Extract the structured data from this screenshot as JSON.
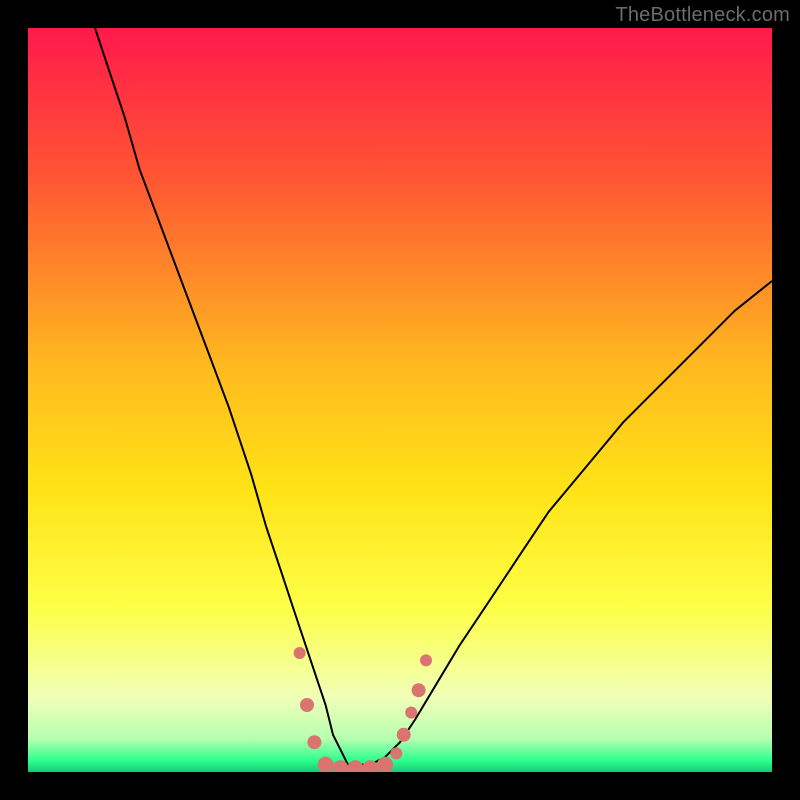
{
  "watermark": {
    "text": "TheBottleneck.com"
  },
  "chart_data": {
    "type": "line",
    "title": "",
    "xlabel": "",
    "ylabel": "",
    "xlim": [
      0,
      100
    ],
    "ylim": [
      0,
      100
    ],
    "grid": false,
    "background_gradient_stops": [
      {
        "offset": 0.0,
        "color": "#ff1a4b"
      },
      {
        "offset": 0.2,
        "color": "#ff5533"
      },
      {
        "offset": 0.45,
        "color": "#ffb81f"
      },
      {
        "offset": 0.62,
        "color": "#ffe316"
      },
      {
        "offset": 0.78,
        "color": "#fdff47"
      },
      {
        "offset": 0.9,
        "color": "#f0ffb7"
      },
      {
        "offset": 0.955,
        "color": "#b7ffb0"
      },
      {
        "offset": 0.985,
        "color": "#2bff8d"
      },
      {
        "offset": 1.0,
        "color": "#18c878"
      }
    ],
    "series": [
      {
        "name": "bottleneck-curve",
        "color": "#000000",
        "x": [
          9,
          11,
          13,
          15,
          18,
          21,
          24,
          27,
          30,
          32,
          34,
          36,
          38,
          40,
          41,
          42,
          43,
          44,
          46,
          48,
          50,
          52,
          55,
          58,
          62,
          66,
          70,
          75,
          80,
          85,
          90,
          95,
          100
        ],
        "y": [
          100,
          94,
          88,
          81,
          73,
          65,
          57,
          49,
          40,
          33,
          27,
          21,
          15,
          9,
          5,
          3,
          1,
          1,
          1,
          2,
          4,
          7,
          12,
          17,
          23,
          29,
          35,
          41,
          47,
          52,
          57,
          62,
          66
        ]
      }
    ],
    "markers": {
      "name": "bottleneck-sweet-spot",
      "color": "#d9746e",
      "points": [
        {
          "x": 36.5,
          "y": 16,
          "r": 6
        },
        {
          "x": 37.5,
          "y": 9,
          "r": 7
        },
        {
          "x": 38.5,
          "y": 4,
          "r": 7
        },
        {
          "x": 40.0,
          "y": 1,
          "r": 8
        },
        {
          "x": 42.0,
          "y": 0.5,
          "r": 8
        },
        {
          "x": 44.0,
          "y": 0.5,
          "r": 8
        },
        {
          "x": 46.0,
          "y": 0.5,
          "r": 8
        },
        {
          "x": 48.0,
          "y": 1,
          "r": 8
        },
        {
          "x": 49.5,
          "y": 2.5,
          "r": 6
        },
        {
          "x": 50.5,
          "y": 5,
          "r": 7
        },
        {
          "x": 51.5,
          "y": 8,
          "r": 6
        },
        {
          "x": 52.5,
          "y": 11,
          "r": 7
        },
        {
          "x": 53.5,
          "y": 15,
          "r": 6
        }
      ]
    }
  }
}
